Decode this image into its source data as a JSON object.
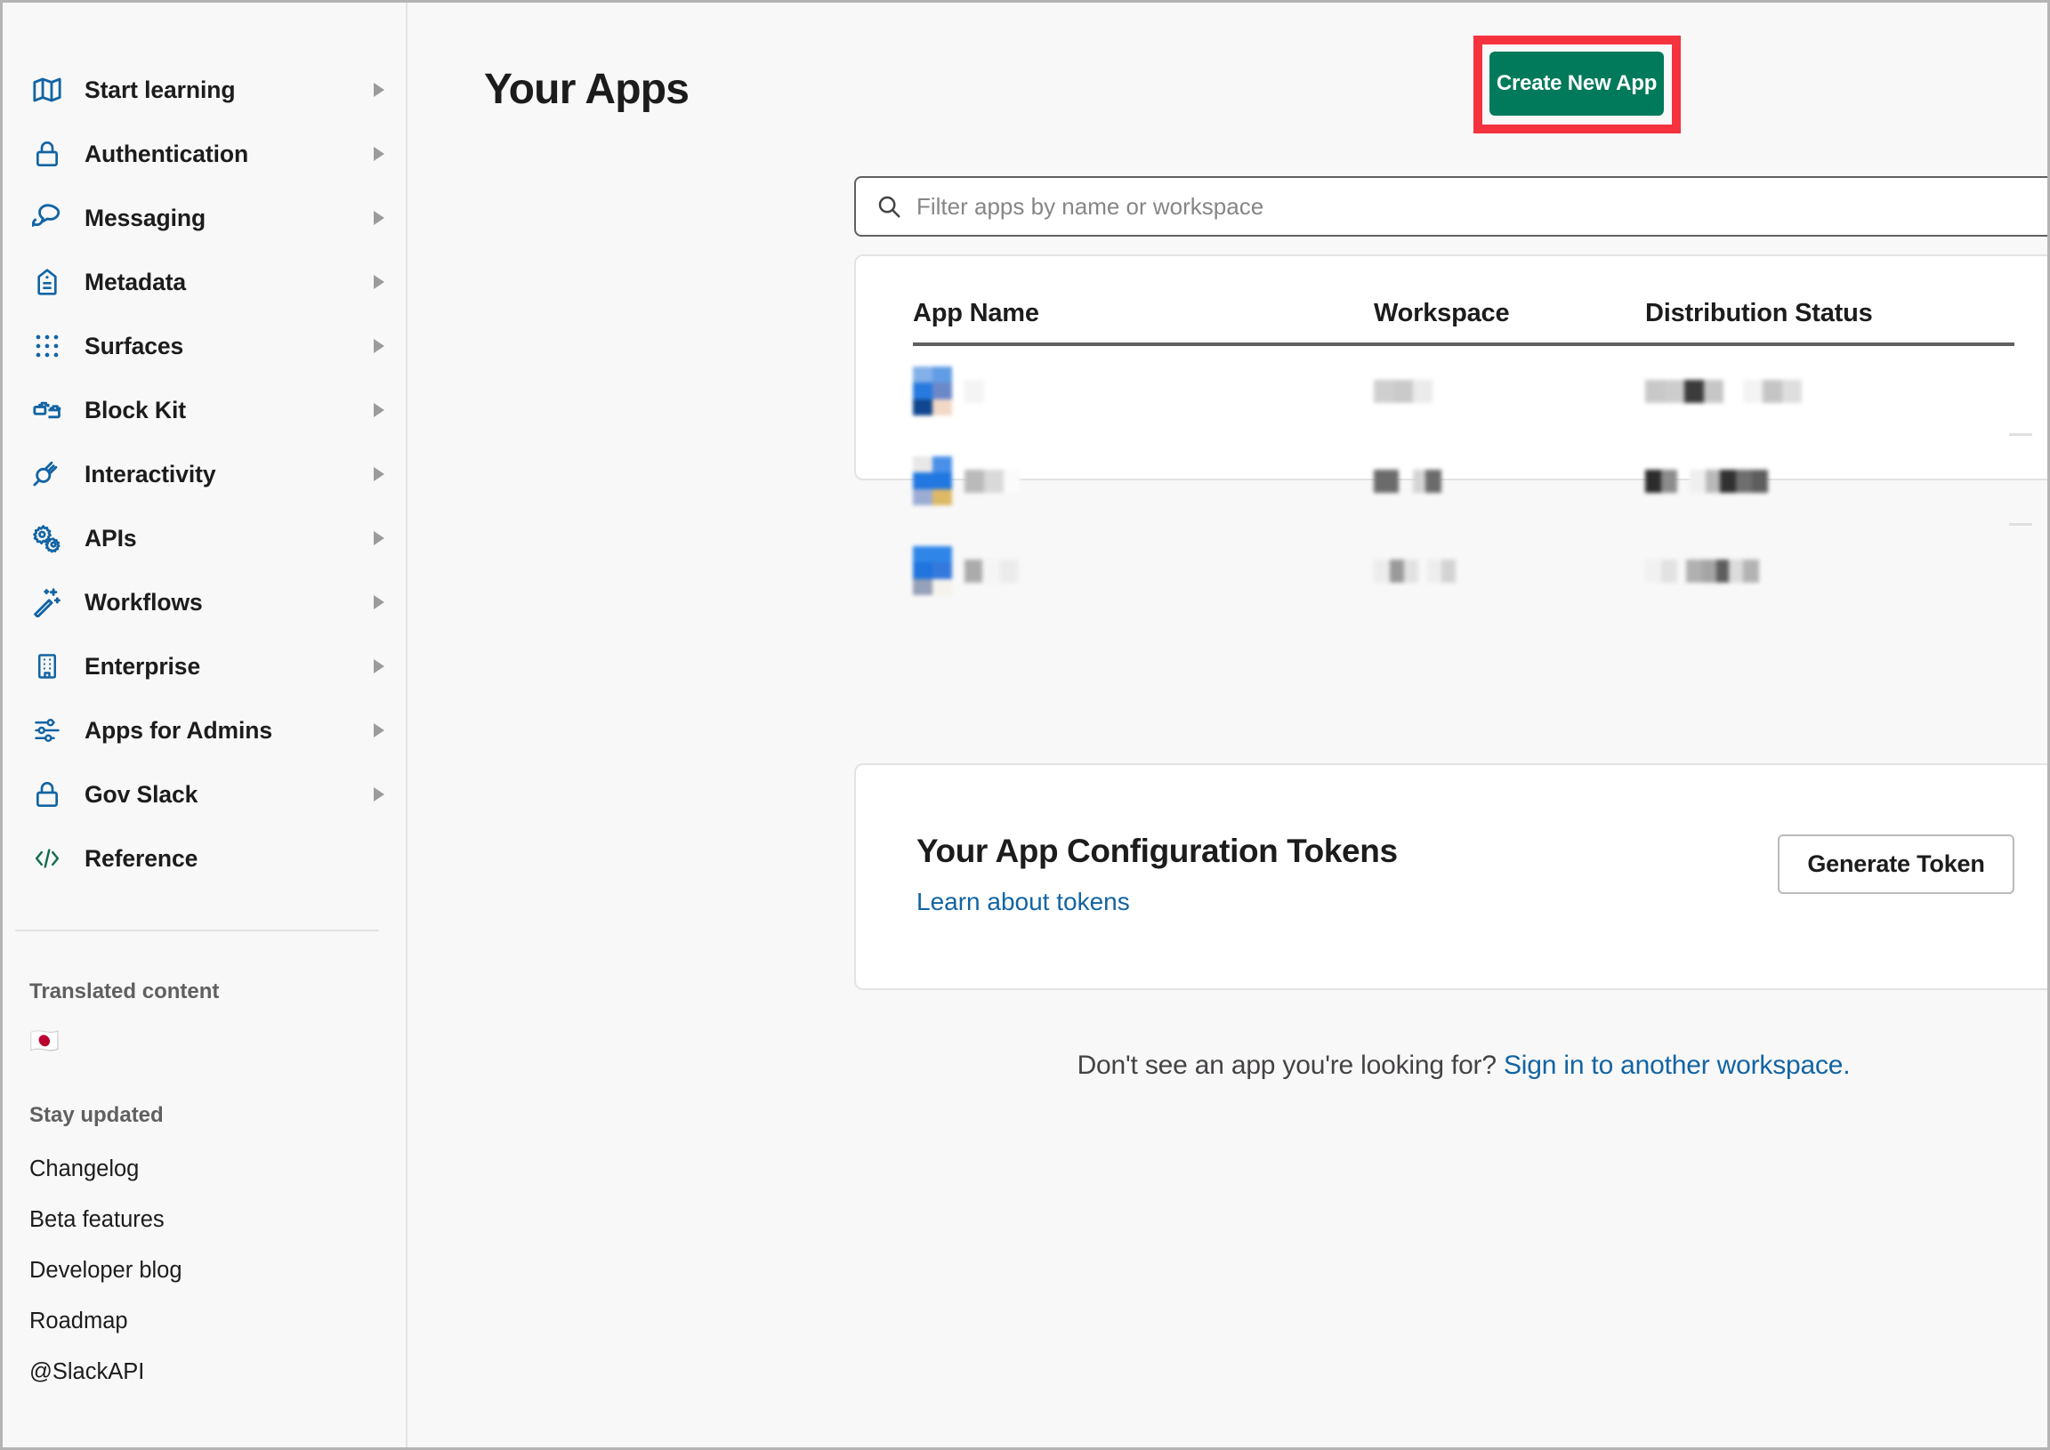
{
  "sidebar": {
    "nav_items": [
      {
        "label": "Start learning",
        "icon": "map-icon",
        "has_chevron": true
      },
      {
        "label": "Authentication",
        "icon": "lock-icon",
        "has_chevron": true
      },
      {
        "label": "Messaging",
        "icon": "chat-icon",
        "has_chevron": true
      },
      {
        "label": "Metadata",
        "icon": "tag-icon",
        "has_chevron": true
      },
      {
        "label": "Surfaces",
        "icon": "grid-dots-icon",
        "has_chevron": true
      },
      {
        "label": "Block Kit",
        "icon": "blocks-icon",
        "has_chevron": true
      },
      {
        "label": "Interactivity",
        "icon": "plug-icon",
        "has_chevron": true
      },
      {
        "label": "APIs",
        "icon": "gears-icon",
        "has_chevron": true
      },
      {
        "label": "Workflows",
        "icon": "magic-wand-icon",
        "has_chevron": true
      },
      {
        "label": "Enterprise",
        "icon": "building-icon",
        "has_chevron": true
      },
      {
        "label": "Apps for Admins",
        "icon": "sliders-icon",
        "has_chevron": true
      },
      {
        "label": "Gov Slack",
        "icon": "lock-icon",
        "has_chevron": true
      },
      {
        "label": "Reference",
        "icon": "code-icon",
        "has_chevron": false
      }
    ],
    "translated_content_heading": "Translated content",
    "translated_content_flag": "🇯🇵",
    "stay_updated_heading": "Stay updated",
    "stay_updated_links": [
      "Changelog",
      "Beta features",
      "Developer blog",
      "Roadmap",
      "@SlackAPI"
    ]
  },
  "main": {
    "page_title": "Your Apps",
    "create_new_app_label": "Create New App",
    "highlight_color": "#f5333f",
    "accent_green": "#007a5a",
    "link_blue": "#1264a3",
    "search": {
      "placeholder": "Filter apps by name or workspace",
      "value": "",
      "icon": "search-icon"
    },
    "apps_table": {
      "columns": [
        "App Name",
        "Workspace",
        "Distribution Status"
      ],
      "rows": [
        {
          "app_name": "[redacted]",
          "workspace": "[redacted]",
          "distribution_status": "[redacted]"
        },
        {
          "app_name": "[redacted]",
          "workspace": "[redacted]",
          "distribution_status": "[redacted]"
        },
        {
          "app_name": "[redacted]",
          "workspace": "[redacted]",
          "distribution_status": "[redacted]"
        }
      ]
    },
    "tokens_card": {
      "title": "Your App Configuration Tokens",
      "learn_link": "Learn about tokens",
      "generate_button": "Generate Token"
    },
    "footer": {
      "text": "Don't see an app you're looking for? ",
      "link": "Sign in to another workspace."
    }
  }
}
